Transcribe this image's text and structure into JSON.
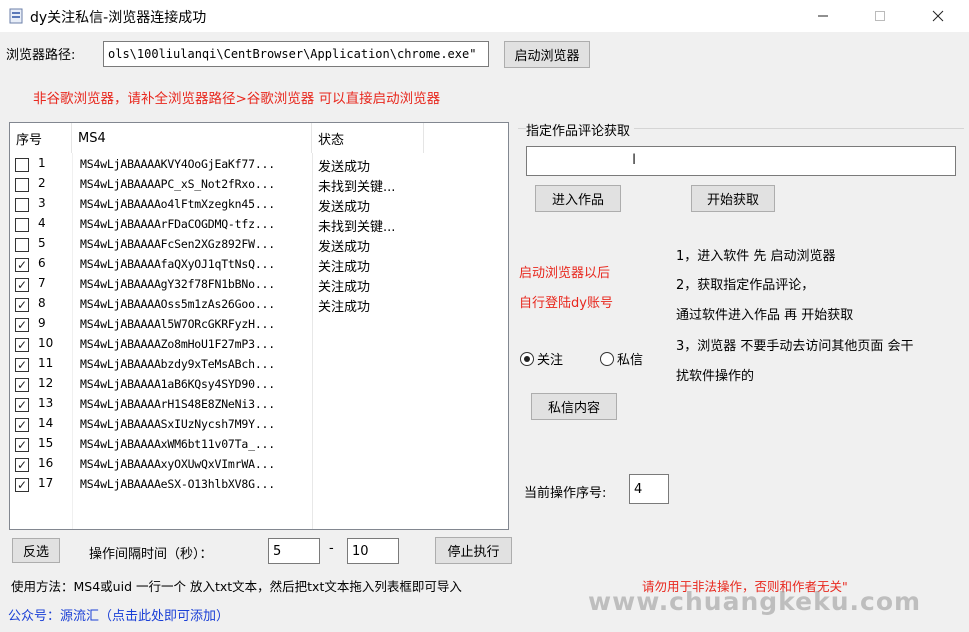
{
  "window": {
    "title": "dy关注私信-浏览器连接成功"
  },
  "browser": {
    "path_label": "浏览器路径:",
    "path_value": "ols\\100liulanqi\\CentBrowser\\Application\\chrome.exe\"",
    "launch_button": "启动浏览器",
    "note": "非谷歌浏览器，请补全浏览器路径>谷歌浏览器 可以直接启动浏览器"
  },
  "table": {
    "headers": [
      "序号",
      "MS4",
      "状态"
    ],
    "rows": [
      {
        "checked": false,
        "idx": "1",
        "ms4": "MS4wLjABAAAAKVY4OoGjEaKf77...",
        "status": "发送成功"
      },
      {
        "checked": false,
        "idx": "2",
        "ms4": "MS4wLjABAAAAPC_xS_Not2fRxo...",
        "status": "未找到关键..."
      },
      {
        "checked": false,
        "idx": "3",
        "ms4": "MS4wLjABAAAAo4lFtmXzegkn45...",
        "status": "发送成功"
      },
      {
        "checked": false,
        "idx": "4",
        "ms4": "MS4wLjABAAAArFDaCOGDMQ-tfz...",
        "status": "未找到关键..."
      },
      {
        "checked": false,
        "idx": "5",
        "ms4": "MS4wLjABAAAAFcSen2XGz892FW...",
        "status": "发送成功"
      },
      {
        "checked": true,
        "idx": "6",
        "ms4": "MS4wLjABAAAAfaQXyOJ1qTtNsQ...",
        "status": "关注成功"
      },
      {
        "checked": true,
        "idx": "7",
        "ms4": "MS4wLjABAAAAgY32f78FN1bBNo...",
        "status": "关注成功"
      },
      {
        "checked": true,
        "idx": "8",
        "ms4": "MS4wLjABAAAAOss5m1zAs26Goo...",
        "status": "关注成功"
      },
      {
        "checked": true,
        "idx": "9",
        "ms4": "MS4wLjABAAAAl5W7ORcGKRFyzH...",
        "status": ""
      },
      {
        "checked": true,
        "idx": "10",
        "ms4": "MS4wLjABAAAAZo8mHoU1F27mP3...",
        "status": ""
      },
      {
        "checked": true,
        "idx": "11",
        "ms4": "MS4wLjABAAAAbzdy9xTeMsABch...",
        "status": ""
      },
      {
        "checked": true,
        "idx": "12",
        "ms4": "MS4wLjABAAAA1aB6KQsy4SYD90...",
        "status": ""
      },
      {
        "checked": true,
        "idx": "13",
        "ms4": "MS4wLjABAAAArH1S48E8ZNeNi3...",
        "status": ""
      },
      {
        "checked": true,
        "idx": "14",
        "ms4": "MS4wLjABAAAASxIUzNycsh7M9Y...",
        "status": ""
      },
      {
        "checked": true,
        "idx": "15",
        "ms4": "MS4wLjABAAAAxWM6bt11v07Ta_...",
        "status": ""
      },
      {
        "checked": true,
        "idx": "16",
        "ms4": "MS4wLjABAAAAxyOXUwQxVImrWA...",
        "status": ""
      },
      {
        "checked": true,
        "idx": "17",
        "ms4": "MS4wLjABAAAAeSX-O13hlbXV8G...",
        "status": ""
      }
    ]
  },
  "comments": {
    "group_label": "指定作品评论获取",
    "url_value": "",
    "enter_button": "进入作品",
    "start_button": "开始获取"
  },
  "hint": {
    "line1": "启动浏览器以后",
    "line2": "自行登陆dy账号"
  },
  "instructions": [
    "1，进入软件 先 启动浏览器",
    "2，获取指定作品评论，",
    "通过软件进入作品 再 开始获取",
    "3，浏览器 不要手动去访问其他页面 会干",
    "扰软件操作的"
  ],
  "mode": {
    "follow": "关注",
    "message": "私信",
    "selected": "follow"
  },
  "dm_button": "私信内容",
  "current": {
    "label": "当前操作序号:",
    "value": "4"
  },
  "bottom": {
    "invert_button": "反选",
    "interval_label": "操作间隔时间（秒）：",
    "interval_min": "5",
    "dash": "-",
    "interval_max": "10",
    "stop_button": "停止执行",
    "usage": "使用方法：MS4或uid 一行一个 放入txt文本，然后把txt文本拖入列表框即可导入",
    "warning": "请勿用于非法操作，否则和作者无关\"",
    "public_account": "公众号：源流汇（点击此处即可添加）",
    "watermark": "www.chuangkeku.com"
  },
  "colors": {
    "red": "#e8281e",
    "blue": "#1a3fd6"
  }
}
